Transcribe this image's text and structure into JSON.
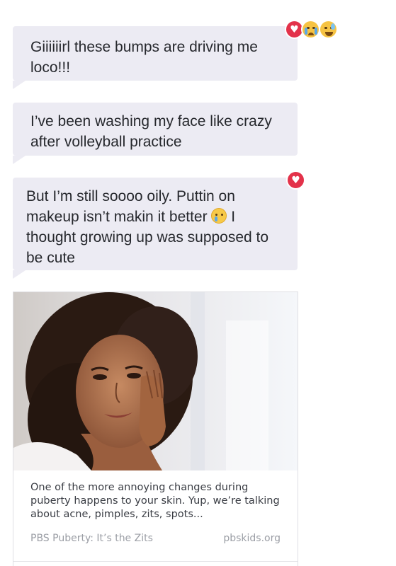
{
  "messages": [
    {
      "text": "Giiiiiirl these bumps are driving me loco!!!",
      "reactions": [
        "heart-icon",
        "crying-face-icon",
        "sweat-smile-face-icon"
      ]
    },
    {
      "text": "I’ve been washing my face like crazy after volleyball practice"
    },
    {
      "text_before": "But I’m still soooo oily. Puttin on makeup isn’t makin it better",
      "inline_emoji": "sad-tear-face-icon",
      "text_after": "I thought growing up was supposed to be cute",
      "reactions": [
        "heart-icon"
      ]
    }
  ],
  "link_card": {
    "image": "woman-touching-face-photo",
    "description": "One of the more annoying changes during puberty happens to your skin. Yup, we’re talking about acne, pimples, zits, spots...",
    "source": "PBS Puberty: It’s the Zits",
    "domain": "pbskids.org"
  },
  "colors": {
    "bubble": "#ecebf3",
    "heart": "#e3324a",
    "emoji": "#f6c343"
  }
}
